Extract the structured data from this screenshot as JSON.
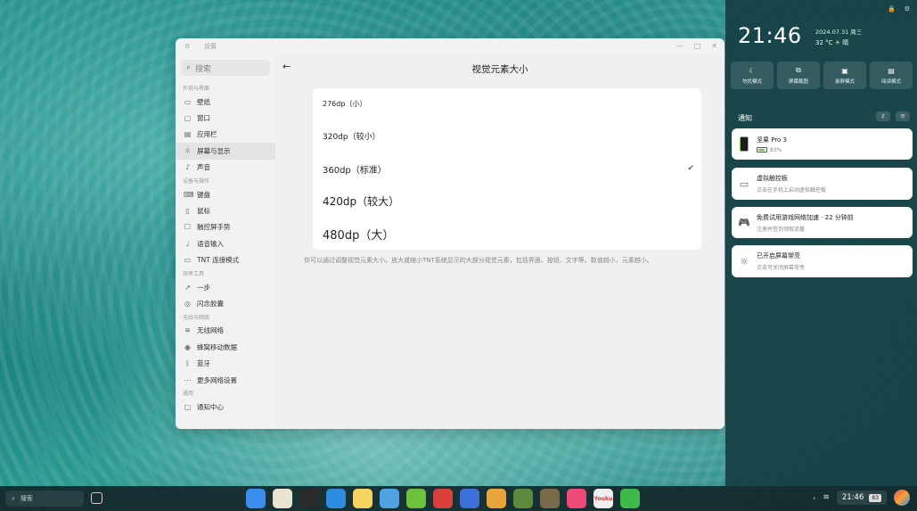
{
  "window": {
    "title": "设置",
    "controls": [
      "—",
      "□",
      "✕"
    ]
  },
  "sidebar": {
    "search_placeholder": "搜索",
    "sections": [
      {
        "header": "外观与界面",
        "items": [
          {
            "label": "壁纸",
            "icon": "image-icon"
          },
          {
            "label": "窗口",
            "icon": "window-icon"
          },
          {
            "label": "应用栏",
            "icon": "dock-icon"
          },
          {
            "label": "屏幕与显示",
            "icon": "display-icon",
            "active": true
          },
          {
            "label": "声音",
            "icon": "bell-icon"
          }
        ]
      },
      {
        "header": "设备与操作",
        "items": [
          {
            "label": "键盘",
            "icon": "keyboard-icon"
          },
          {
            "label": "鼠标",
            "icon": "mouse-icon"
          },
          {
            "label": "触控屏手势",
            "icon": "touch-icon"
          },
          {
            "label": "语音输入",
            "icon": "mic-icon"
          },
          {
            "label": "TNT 连接模式",
            "icon": "monitor-icon"
          }
        ]
      },
      {
        "header": "效率工具",
        "items": [
          {
            "label": "一步",
            "icon": "step-icon"
          },
          {
            "label": "闪念胶囊",
            "icon": "capsule-icon"
          }
        ]
      },
      {
        "header": "无线与网络",
        "items": [
          {
            "label": "无线网络",
            "icon": "wifi-icon"
          },
          {
            "label": "蜂窝移动数据",
            "icon": "cellular-icon"
          },
          {
            "label": "蓝牙",
            "icon": "bluetooth-icon"
          },
          {
            "label": "更多网络设置",
            "icon": "more-icon"
          }
        ]
      },
      {
        "header": "通用",
        "items": [
          {
            "label": "通知中心",
            "icon": "notification-icon"
          }
        ]
      }
    ]
  },
  "main": {
    "title": "视觉元素大小",
    "options": [
      {
        "label": "276dp（小）",
        "selected": false
      },
      {
        "label": "320dp（较小）",
        "selected": false
      },
      {
        "label": "360dp（标准）",
        "selected": true
      },
      {
        "label": "420dp（较大）",
        "selected": false
      },
      {
        "label": "480dp（大）",
        "selected": false
      }
    ],
    "description": "你可以通过调整视觉元素大小，放大或缩小TNT系统显示的大部分视觉元素，包括界面、按钮、文字等。数值越小，元素越小。"
  },
  "panel": {
    "clock": "21:46",
    "date": "2024.07.31 周三",
    "temp": "32 °C",
    "weather": "晴",
    "quick_toggles": [
      {
        "label": "勿扰模式",
        "icon": "moon-icon"
      },
      {
        "label": "屏幕截图",
        "icon": "screenshot-icon"
      },
      {
        "label": "录屏模式",
        "icon": "record-icon"
      },
      {
        "label": "阅读模式",
        "icon": "book-icon"
      }
    ],
    "notifications_title": "通知",
    "notifications": [
      {
        "title": "坚果 Pro 3",
        "sub": "83%",
        "icon": "phone-icon"
      },
      {
        "title": "虚拟触控板",
        "sub": "点击在手机上启动虚拟触控板",
        "icon": "touchpad-icon"
      },
      {
        "title": "免费试用游戏网络加速 · 22 分钟前",
        "sub": "注册并签到领取流量",
        "icon": "gamepad-icon"
      },
      {
        "title": "已开启屏幕常亮",
        "sub": "点击可关闭屏幕常亮",
        "icon": "sun-icon"
      }
    ]
  },
  "taskbar": {
    "search_placeholder": "搜索",
    "apps": [
      {
        "name": "launcher",
        "color": "#3a8ef0",
        "label": ""
      },
      {
        "name": "calendar",
        "color": "#e9e4d0",
        "label": ""
      },
      {
        "name": "steam",
        "color": "#2a2a2a",
        "label": ""
      },
      {
        "name": "browser",
        "color": "#2f8de0",
        "label": ""
      },
      {
        "name": "notes",
        "color": "#f4d35e",
        "label": ""
      },
      {
        "name": "photos",
        "color": "#4fa3e0",
        "label": ""
      },
      {
        "name": "files",
        "color": "#6cc23a",
        "label": ""
      },
      {
        "name": "store",
        "color": "#d8413a",
        "label": ""
      },
      {
        "name": "game-1",
        "color": "#3d6fd8",
        "label": ""
      },
      {
        "name": "game-2",
        "color": "#e8a43a",
        "label": ""
      },
      {
        "name": "game-3",
        "color": "#5a8a3a",
        "label": ""
      },
      {
        "name": "game-4",
        "color": "#7a6a4a",
        "label": ""
      },
      {
        "name": "game-5",
        "color": "#ee4a7a",
        "label": ""
      },
      {
        "name": "youku",
        "color": "#f0f0f0",
        "label": "Youku"
      },
      {
        "name": "wechat",
        "color": "#3fb94a",
        "label": ""
      }
    ],
    "time": "21:46",
    "battery": "83"
  }
}
